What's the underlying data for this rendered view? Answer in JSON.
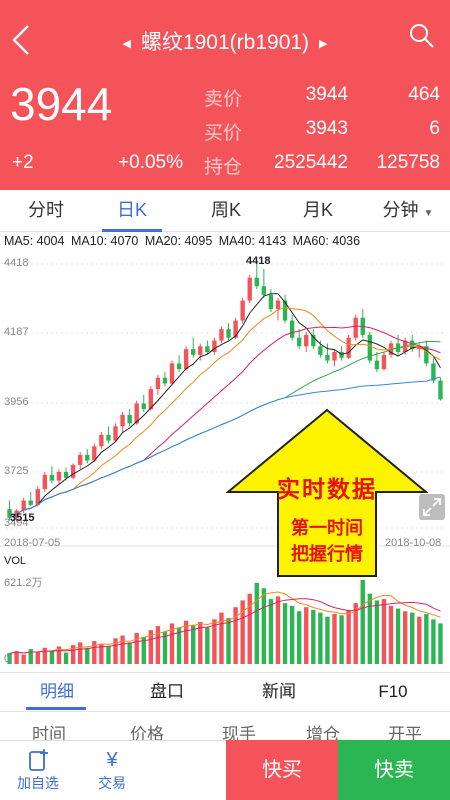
{
  "header": {
    "title": "螺纹1901(rb1901)",
    "last_price": "3944",
    "change_abs": "+2",
    "change_pct": "+0.05%",
    "quotes": [
      {
        "label": "卖价",
        "v1": "3944",
        "v2": "464"
      },
      {
        "label": "买价",
        "v1": "3943",
        "v2": "6"
      },
      {
        "label": "持仓",
        "v1": "2525442",
        "v2": "125758"
      }
    ]
  },
  "periods": [
    "分时",
    "日K",
    "周K",
    "月K",
    "分钟"
  ],
  "ma": [
    {
      "label": "MA5: 4004",
      "color": "#222222"
    },
    {
      "label": "MA10: 4070",
      "color": "#f08a18"
    },
    {
      "label": "MA20: 4095",
      "color": "#d6246b"
    },
    {
      "label": "MA40: 4143",
      "color": "#2fa84f"
    },
    {
      "label": "MA60: 4036",
      "color": "#3a84e0"
    }
  ],
  "chart": {
    "y_labels": [
      "4418",
      "4187",
      "3956",
      "3725",
      "3494"
    ],
    "high_marker": "4418",
    "low_marker": "3515",
    "date_start": "2018-07-05",
    "date_end": "2018-10-08",
    "vol_label": "VOL",
    "vol_max": "621.2万",
    "vol_min": "0",
    "up_color": "#f4535a",
    "down_color": "#2bb653"
  },
  "chart_data": {
    "type": "candlestick",
    "ylim": [
      3494,
      4418
    ],
    "ohlc": [
      [
        3560,
        3590,
        3520,
        3530
      ],
      [
        3530,
        3560,
        3515,
        3555
      ],
      [
        3555,
        3600,
        3545,
        3590
      ],
      [
        3590,
        3620,
        3570,
        3575
      ],
      [
        3575,
        3640,
        3570,
        3630
      ],
      [
        3630,
        3690,
        3620,
        3680
      ],
      [
        3680,
        3710,
        3650,
        3660
      ],
      [
        3660,
        3700,
        3650,
        3690
      ],
      [
        3690,
        3705,
        3660,
        3670
      ],
      [
        3670,
        3720,
        3665,
        3715
      ],
      [
        3715,
        3760,
        3700,
        3750
      ],
      [
        3750,
        3770,
        3720,
        3730
      ],
      [
        3730,
        3790,
        3725,
        3780
      ],
      [
        3780,
        3830,
        3770,
        3820
      ],
      [
        3820,
        3850,
        3790,
        3800
      ],
      [
        3800,
        3860,
        3795,
        3850
      ],
      [
        3850,
        3900,
        3830,
        3890
      ],
      [
        3890,
        3910,
        3850,
        3860
      ],
      [
        3860,
        3940,
        3855,
        3930
      ],
      [
        3930,
        3960,
        3900,
        3910
      ],
      [
        3910,
        3990,
        3905,
        3980
      ],
      [
        3980,
        4030,
        3960,
        4020
      ],
      [
        4020,
        4040,
        3990,
        4000
      ],
      [
        4000,
        4080,
        3995,
        4070
      ],
      [
        4070,
        4100,
        4040,
        4050
      ],
      [
        4050,
        4130,
        4045,
        4120
      ],
      [
        4120,
        4160,
        4090,
        4100
      ],
      [
        4100,
        4140,
        4080,
        4130
      ],
      [
        4130,
        4150,
        4100,
        4110
      ],
      [
        4110,
        4160,
        4100,
        4150
      ],
      [
        4150,
        4200,
        4140,
        4190
      ],
      [
        4190,
        4210,
        4150,
        4160
      ],
      [
        4160,
        4230,
        4155,
        4220
      ],
      [
        4220,
        4300,
        4210,
        4290
      ],
      [
        4290,
        4380,
        4280,
        4370
      ],
      [
        4370,
        4418,
        4330,
        4340
      ],
      [
        4340,
        4400,
        4300,
        4310
      ],
      [
        4310,
        4330,
        4250,
        4260
      ],
      [
        4260,
        4300,
        4220,
        4290
      ],
      [
        4290,
        4310,
        4210,
        4220
      ],
      [
        4220,
        4240,
        4150,
        4160
      ],
      [
        4160,
        4190,
        4120,
        4130
      ],
      [
        4130,
        4180,
        4110,
        4170
      ],
      [
        4170,
        4190,
        4120,
        4130
      ],
      [
        4130,
        4150,
        4090,
        4100
      ],
      [
        4100,
        4140,
        4070,
        4080
      ],
      [
        4080,
        4120,
        4060,
        4110
      ],
      [
        4110,
        4130,
        4080,
        4090
      ],
      [
        4090,
        4170,
        4085,
        4160
      ],
      [
        4160,
        4240,
        4150,
        4230
      ],
      [
        4230,
        4260,
        4160,
        4170
      ],
      [
        4170,
        4180,
        4070,
        4080
      ],
      [
        4080,
        4110,
        4040,
        4050
      ],
      [
        4050,
        4110,
        4045,
        4100
      ],
      [
        4100,
        4150,
        4090,
        4140
      ],
      [
        4140,
        4170,
        4100,
        4110
      ],
      [
        4110,
        4160,
        4100,
        4150
      ],
      [
        4150,
        4170,
        4110,
        4120
      ],
      [
        4120,
        4140,
        4090,
        4130
      ],
      [
        4130,
        4150,
        4060,
        4070
      ],
      [
        4070,
        4090,
        4000,
        4010
      ],
      [
        4010,
        4020,
        3940,
        3944
      ]
    ],
    "volume": [
      80,
      95,
      70,
      110,
      90,
      120,
      100,
      130,
      85,
      140,
      160,
      120,
      170,
      150,
      130,
      190,
      210,
      160,
      230,
      200,
      250,
      280,
      240,
      300,
      270,
      320,
      290,
      310,
      270,
      330,
      380,
      340,
      420,
      470,
      520,
      600,
      560,
      480,
      500,
      450,
      430,
      390,
      420,
      400,
      380,
      350,
      370,
      360,
      400,
      450,
      621,
      520,
      470,
      480,
      430,
      410,
      390,
      380,
      350,
      370,
      330,
      300
    ]
  },
  "callout": {
    "title": "实时数据",
    "line1": "第一时间",
    "line2": "把握行情"
  },
  "tabs2": [
    "明细",
    "盘口",
    "新闻",
    "F10"
  ],
  "columns": [
    "时间",
    "价格",
    "现手",
    "增仓",
    "开平"
  ],
  "bottom": {
    "watch_label": "加自选",
    "watch_icon": "add-watchlist-icon",
    "trade_label": "交易",
    "trade_icon": "yen-icon",
    "trade_symbol": "¥",
    "buy_label": "快买",
    "sell_label": "快卖"
  }
}
